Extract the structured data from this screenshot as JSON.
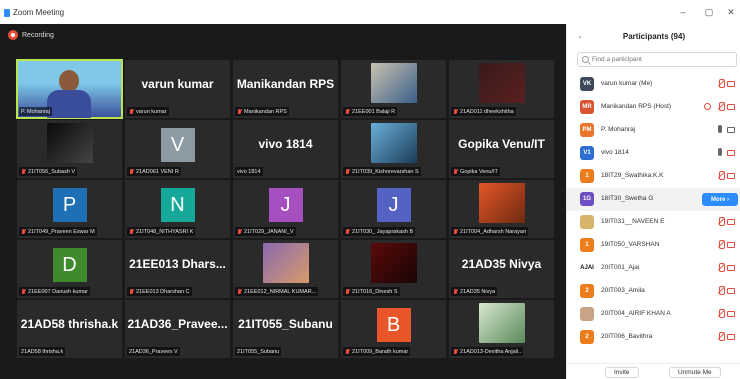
{
  "window": {
    "title": "Zoom Meeting",
    "minimize": "–",
    "restore": "▢",
    "close": "✕"
  },
  "recording": {
    "label": "Recording",
    "color": "#e84c3d"
  },
  "colors": {
    "accent": "#2d8cff",
    "active_speaker": "#b9e34f",
    "muted": "#e84c3d"
  },
  "tiles": [
    {
      "kind": "video",
      "label": "P. Mohanraj",
      "active": true,
      "muted": false,
      "photo_colors": [
        "#7fc8e8",
        "#3a4d9a"
      ]
    },
    {
      "kind": "name",
      "display": "varun kumar",
      "label": "varun kumar",
      "muted": true
    },
    {
      "kind": "name",
      "display": "Manikandan RPS",
      "label": "Manikandan RPS",
      "muted": true
    },
    {
      "kind": "photo",
      "label": "21EE001 Balaji R",
      "muted": true,
      "photo_colors": [
        "#c9c2b0",
        "#3b5f8a"
      ]
    },
    {
      "kind": "photo",
      "label": "21AD011 dheekshitha",
      "muted": true,
      "photo_colors": [
        "#3a1a1a",
        "#5a2020"
      ]
    },
    {
      "kind": "photo",
      "label": "21IT056_Subash V",
      "muted": true,
      "photo_colors": [
        "#0a0a0a",
        "#444"
      ]
    },
    {
      "kind": "letter",
      "letter": "V",
      "bg": "#8b9aa3",
      "label": "21AD061 VENI R",
      "muted": true
    },
    {
      "kind": "name",
      "display": "vivo 1814",
      "label": "vivo 1814",
      "muted": false
    },
    {
      "kind": "photo",
      "label": "21IT039_Kishorevarshan S",
      "muted": true,
      "photo_colors": [
        "#6ab0d8",
        "#1c3c5a"
      ]
    },
    {
      "kind": "name",
      "display": "Gopika Venu/IT",
      "label": "Gopika Venu/IT",
      "muted": true
    },
    {
      "kind": "letter",
      "letter": "P",
      "bg": "#1f6fb5",
      "label": "21IT049_Praveen Eswar M",
      "muted": true
    },
    {
      "kind": "letter",
      "letter": "N",
      "bg": "#16a89a",
      "label": "21IT048_NITHYASRI K",
      "muted": true
    },
    {
      "kind": "letter",
      "letter": "J",
      "bg": "#a64fc1",
      "label": "21IT029_JANANI_V",
      "muted": true
    },
    {
      "kind": "letter",
      "letter": "J",
      "bg": "#5462c4",
      "label": "21IT030_ Jayaprakash B",
      "muted": true
    },
    {
      "kind": "photo",
      "label": "21IT004_Adharsh Narayan",
      "muted": true,
      "photo_colors": [
        "#e5572a",
        "#6e2a10"
      ]
    },
    {
      "kind": "letter",
      "letter": "D",
      "bg": "#3f8a2e",
      "label": "21EE007 Danush kumar",
      "muted": true
    },
    {
      "kind": "name",
      "display": "21EE013 Dhars...",
      "label": "21EE013 Dharshan C",
      "muted": true
    },
    {
      "kind": "photo",
      "label": "21EE012_NIRMAL KUMAR...",
      "muted": true,
      "photo_colors": [
        "#8a6ab0",
        "#d89a6a"
      ]
    },
    {
      "kind": "photo",
      "label": "21IT016_Dinesh S",
      "muted": true,
      "photo_colors": [
        "#5a0a0a",
        "#1a0505"
      ]
    },
    {
      "kind": "name",
      "display": "21AD35 Nivya",
      "label": "21AD35 Nivya",
      "muted": true
    },
    {
      "kind": "name",
      "display": "21AD58 thrisha.k",
      "label": "21AD58 thrisha.k",
      "muted": false
    },
    {
      "kind": "name",
      "display": "21AD36_Pravee...",
      "label": "21AD36_Praveen V",
      "muted": false
    },
    {
      "kind": "name",
      "display": "21IT055_Subanu",
      "label": "21IT055_Subanu",
      "muted": false
    },
    {
      "kind": "letter",
      "letter": "B",
      "bg": "#e8562a",
      "label": "21IT009_Barath kumar",
      "muted": true
    },
    {
      "kind": "photo",
      "label": "21AD013-Devitha Anjali..",
      "muted": true,
      "photo_colors": [
        "#d7e7d0",
        "#5a8a5a"
      ]
    }
  ],
  "panel": {
    "collapse_icon": "⌄",
    "title": "Participants (94)",
    "search_placeholder": "Find a participant",
    "more_label": "More ›",
    "participants": [
      {
        "initials": "VK",
        "bg": "#3d4a5a",
        "name": "varun kumar (Me)",
        "mic": "muted",
        "cam": "off"
      },
      {
        "initials": "MR",
        "bg": "#d9542f",
        "name": "Manikandan RPS (Host)",
        "mic": "muted",
        "cam": "off",
        "share": true
      },
      {
        "initials": "PM",
        "bg": "#e8762a",
        "name": "P. Mohanraj",
        "mic": "on",
        "cam": "on"
      },
      {
        "initials": "V1",
        "bg": "#2d6fd0",
        "name": "vivo 1814",
        "mic": "on",
        "cam": "off"
      },
      {
        "initials": "1",
        "bg": "#ec7c1c",
        "name": "18IT29_Swathika.K.K",
        "mic": "muted",
        "cam": "off"
      },
      {
        "initials": "1G",
        "bg": "#6c4fc2",
        "name": "18IT30_Swetha G",
        "mic": "",
        "cam": "",
        "hover": true
      },
      {
        "initials": "",
        "bg": "#d8b46a",
        "name": "19IT031__NAVEEN E",
        "mic": "muted",
        "cam": "off"
      },
      {
        "initials": "1",
        "bg": "#ec7c1c",
        "name": "19IT050_VARSHAN",
        "mic": "muted",
        "cam": "off"
      },
      {
        "initials": "AJAI",
        "bg": "#ffffff",
        "fg": "#111",
        "name": "20IT001_Ajai",
        "mic": "muted",
        "cam": "off"
      },
      {
        "initials": "2",
        "bg": "#ec7c1c",
        "name": "20IT003_Amila",
        "mic": "muted",
        "cam": "off"
      },
      {
        "initials": "",
        "bg": "#c9a383",
        "name": "20IT004_AIRIF KHAN A",
        "mic": "muted",
        "cam": "off"
      },
      {
        "initials": "2",
        "bg": "#ec7c1c",
        "name": "20IT006_Bavithra",
        "mic": "muted",
        "cam": "off"
      }
    ],
    "invite_label": "Invite",
    "mute_all_label": "Unmute Me"
  }
}
